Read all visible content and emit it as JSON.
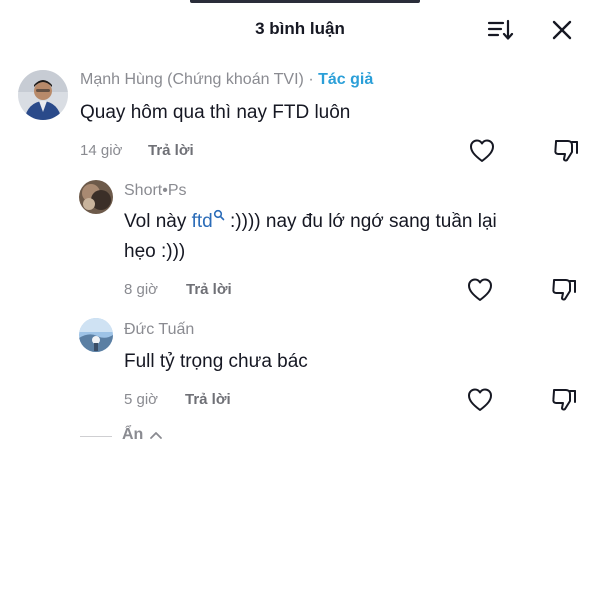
{
  "header": {
    "title": "3 bình luận"
  },
  "comments": [
    {
      "author": "Mạnh Hùng (Chứng khoán TVI)",
      "author_separator": " · ",
      "author_tag": "Tác giả",
      "text": "Quay hôm qua thì nay FTD luôn",
      "time": "14 giờ",
      "reply_label": "Trả lời"
    },
    {
      "author": "Short•Ps",
      "text_before": "Vol này ",
      "text_link": "ftd",
      "text_after": " :)))) nay đu lớ ngớ sang tuần lại",
      "text_line2": "hẹo :)))",
      "time": "8 giờ",
      "reply_label": "Trả lời"
    },
    {
      "author": "Đức Tuấn",
      "text": "Full tỷ trọng chưa bác",
      "time": "5 giờ",
      "reply_label": "Trả lời"
    }
  ],
  "replies_toggle": {
    "label": "Ẩn"
  },
  "icons": {
    "sort": "sort-icon",
    "close": "close-icon",
    "like": "heart-outline-icon",
    "dislike": "thumbs-down-icon",
    "search": "search-icon",
    "chevron": "chevron-up-icon"
  },
  "colors": {
    "author_tag": "#2b9fd8",
    "link": "#2b6cb8",
    "muted_text": "#8a8b91",
    "body_text": "#161823"
  }
}
